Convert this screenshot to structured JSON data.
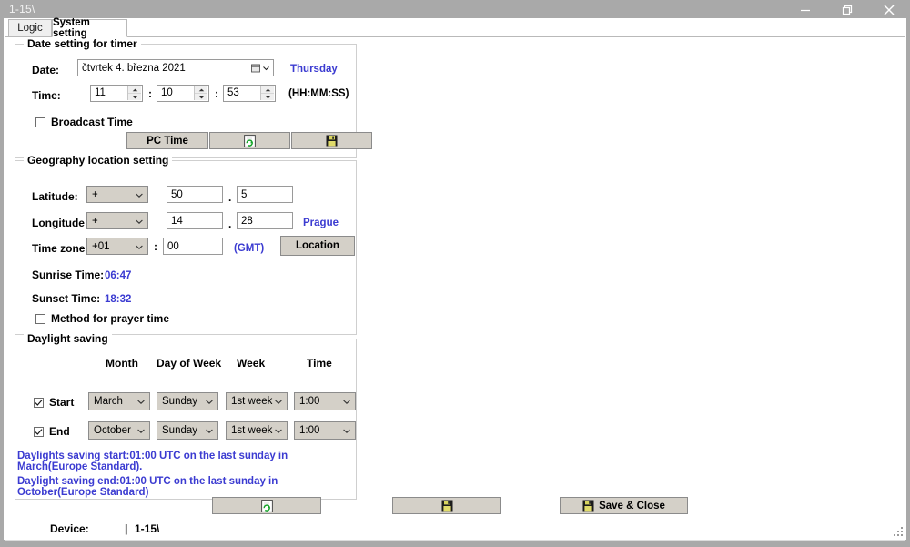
{
  "window": {
    "title": "1-15\\",
    "controls": {
      "minimize": "minimize-icon",
      "restore": "restore-icon",
      "close": "close-icon"
    }
  },
  "tabs": [
    {
      "label": "Logic",
      "active": false
    },
    {
      "label": "System setting",
      "active": true
    }
  ],
  "date_group": {
    "title": "Date setting for timer",
    "date_label": "Date:",
    "date_value": "čtvrtek   4.   března   2021",
    "weekday": "Thursday",
    "time_label": "Time:",
    "hours": "11",
    "minutes": "10",
    "seconds": "53",
    "separator": ":",
    "format_hint": "(HH:MM:SS)",
    "broadcast_label": "Broadcast Time",
    "broadcast_checked": false,
    "pc_time_button": "PC Time",
    "read_button_icon": "read-document-icon",
    "save_button_icon": "save-floppy-icon"
  },
  "geo_group": {
    "title": "Geography location setting",
    "latitude_label": "Latitude:",
    "latitude_sign": "+",
    "latitude_deg": "50",
    "latitude_min": "5",
    "longitude_label": "Longitude:",
    "longitude_sign": "+",
    "longitude_deg": "14",
    "longitude_min": "28",
    "city": "Prague",
    "timezone_label": "Time zone:",
    "timezone_hours": "+01",
    "timezone_sep": ":",
    "timezone_minutes": "00",
    "gmt_label": "(GMT)",
    "location_button": "Location",
    "sunrise_label": "Sunrise Time:",
    "sunrise_value": "06:47",
    "sunset_label": "Sunset Time:",
    "sunset_value": "18:32",
    "prayer_label": "Method for prayer time",
    "prayer_checked": false,
    "decimal_point": "."
  },
  "dst_group": {
    "title": "Daylight saving",
    "headers": [
      "Month",
      "Day of Week",
      "Week",
      "Time"
    ],
    "rows": [
      {
        "label": "Start",
        "checked": true,
        "month": "March",
        "day": "Sunday",
        "week": "1st week",
        "time": "1:00"
      },
      {
        "label": "End",
        "checked": true,
        "month": "October",
        "day": "Sunday",
        "week": "1st week",
        "time": "1:00"
      }
    ],
    "info_start": "Daylights saving start:01:00 UTC on the last sunday in March(Europe Standard).",
    "info_end": "Daylight saving end:01:00 UTC on the last sunday in October(Europe Standard)"
  },
  "footer": {
    "read_button_icon": "read-document-icon",
    "write_button_icon": "save-floppy-icon",
    "save_close_button": "Save & Close",
    "save_close_icon": "save-floppy-icon"
  },
  "statusbar": {
    "device_label": "Device:",
    "device_separator": "|",
    "device_value": "1-15\\"
  },
  "colors": {
    "accent_blue": "#3b3bd1",
    "window_chrome": "#a9a9a9",
    "control_face": "#d4d0c8",
    "client_bg": "#ffffff"
  }
}
